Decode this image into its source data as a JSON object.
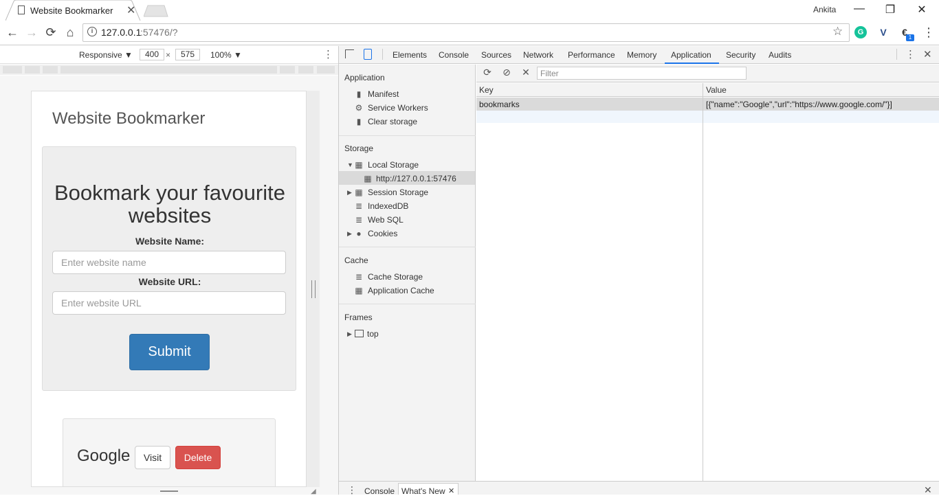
{
  "browser": {
    "tab_title": "Website Bookmarker",
    "tab_close": "✕",
    "user_name": "Ankita",
    "window_controls": {
      "minimize": "—",
      "restore": "❐",
      "close": "✕"
    },
    "nav": {
      "back": "←",
      "forward": "→",
      "reload": "⟳",
      "home": "⌂"
    },
    "url_host": "127.0.0.1",
    "url_rest": ":57476/?",
    "info_icon": "i",
    "star_icon": "☆",
    "extensions": [
      {
        "name": "grammarly-icon",
        "glyph": "G",
        "color": "#15c39a"
      },
      {
        "name": "extension-v-icon",
        "glyph": "V",
        "color": "#2c4f8c"
      },
      {
        "name": "extension-badge-icon",
        "glyph": "€",
        "color": "#333333"
      }
    ],
    "menu_icon": "⋮"
  },
  "device_toolbar": {
    "mode": "Responsive ▼",
    "width": "400",
    "times": "×",
    "height": "575",
    "zoom": "100% ▼",
    "more": "⋮"
  },
  "page": {
    "title": "Website Bookmarker",
    "heading": "Bookmark your favourite websites",
    "name_label": "Website Name:",
    "name_placeholder": "Enter website name",
    "url_label": "Website URL:",
    "url_placeholder": "Enter website URL",
    "submit_label": "Submit",
    "bookmarks": [
      {
        "name": "Google",
        "visit_label": "Visit",
        "delete_label": "Delete"
      }
    ]
  },
  "devtools": {
    "tabs": [
      "Elements",
      "Console",
      "Sources",
      "Network",
      "Performance",
      "Memory",
      "Application",
      "Security",
      "Audits"
    ],
    "active_tab": "Application",
    "more": "⋮",
    "close": "✕",
    "sidebar": {
      "application_head": "Application",
      "application_items": [
        "Manifest",
        "Service Workers",
        "Clear storage"
      ],
      "storage_head": "Storage",
      "local_storage": "Local Storage",
      "local_storage_origin": "http://127.0.0.1:57476",
      "session_storage": "Session Storage",
      "indexeddb": "IndexedDB",
      "websql": "Web SQL",
      "cookies": "Cookies",
      "cache_head": "Cache",
      "cache_items": [
        "Cache Storage",
        "Application Cache"
      ],
      "frames_head": "Frames",
      "frames_top": "top"
    },
    "storage_toolbar": {
      "refresh": "⟳",
      "clear": "⊘",
      "delete": "✕",
      "filter_placeholder": "Filter"
    },
    "grid": {
      "columns": [
        "Key",
        "Value"
      ],
      "rows": [
        {
          "key": "bookmarks",
          "value": "[{\"name\":\"Google\",\"url\":\"https://www.google.com/\"}]"
        }
      ]
    },
    "drawer": {
      "menu": "⋮",
      "tabs": [
        "Console",
        "What's New"
      ],
      "tab_close": "✕",
      "close": "✕"
    }
  }
}
